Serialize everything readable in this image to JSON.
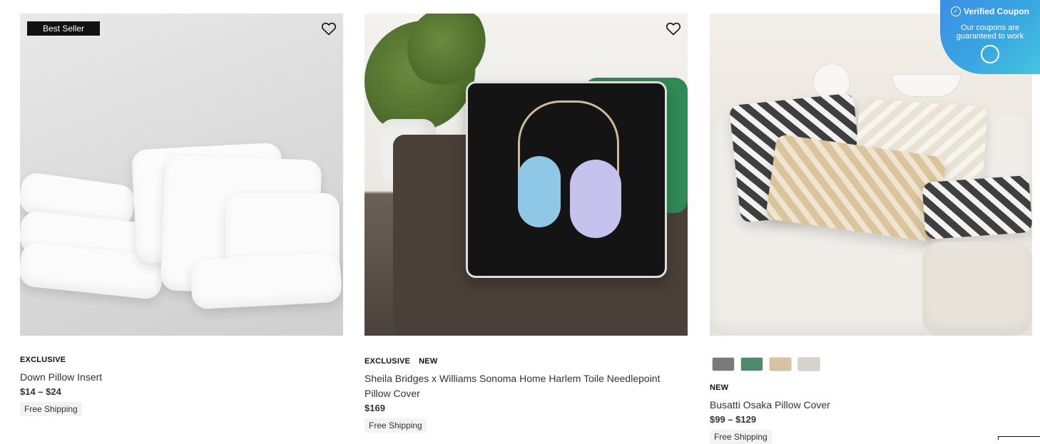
{
  "products": [
    {
      "badge": "Best Seller",
      "tags": [
        "EXCLUSIVE"
      ],
      "name": "Down Pillow Insert",
      "price": "$14 – $24",
      "shipping": "Free Shipping"
    },
    {
      "badge": "",
      "tags": [
        "EXCLUSIVE",
        "NEW"
      ],
      "name": "Sheila Bridges x Williams Sonoma Home Harlem Toile Needlepoint Pillow Cover",
      "price": "$169",
      "shipping": "Free Shipping"
    },
    {
      "badge": "",
      "tags": [
        "NEW"
      ],
      "name": "Busatti Osaka Pillow Cover",
      "price": "$99 – $129",
      "shipping": "Free Shipping",
      "swatch_colors": [
        "#7a7a7a",
        "#4f8a6b",
        "#d8c3a0",
        "#d6d3cc"
      ]
    }
  ],
  "coupon": {
    "title": "Verified Coupon",
    "subtitle": "Our coupons are guaranteed to work"
  },
  "colors": {
    "badge_bg": "#111111",
    "coupon_gradient_start": "#3a8ee6",
    "coupon_gradient_end": "#43c6e0"
  }
}
